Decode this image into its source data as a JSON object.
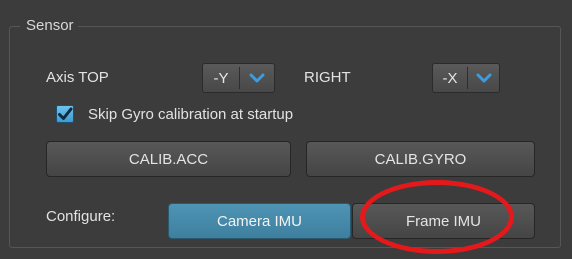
{
  "group": {
    "title": "Sensor"
  },
  "axis": {
    "top_label": "Axis TOP",
    "top_value": "-Y",
    "right_label": "RIGHT",
    "right_value": "-X"
  },
  "skip_gyro": {
    "label": "Skip Gyro calibration at startup",
    "checked": true
  },
  "calibration": {
    "acc_label": "CALIB.ACC",
    "gyro_label": "CALIB.GYRO"
  },
  "configure": {
    "label": "Configure:",
    "options": [
      "Camera IMU",
      "Frame IMU"
    ],
    "selected": "Camera IMU"
  },
  "colors": {
    "accent": "#4a8fb0",
    "checkbox": "#4aa8dc",
    "dropdown_arrow": "#3d9be0",
    "annotation": "#e4191b"
  },
  "icons": {
    "dropdown": "chevron-down-icon",
    "check": "checkmark-icon"
  }
}
